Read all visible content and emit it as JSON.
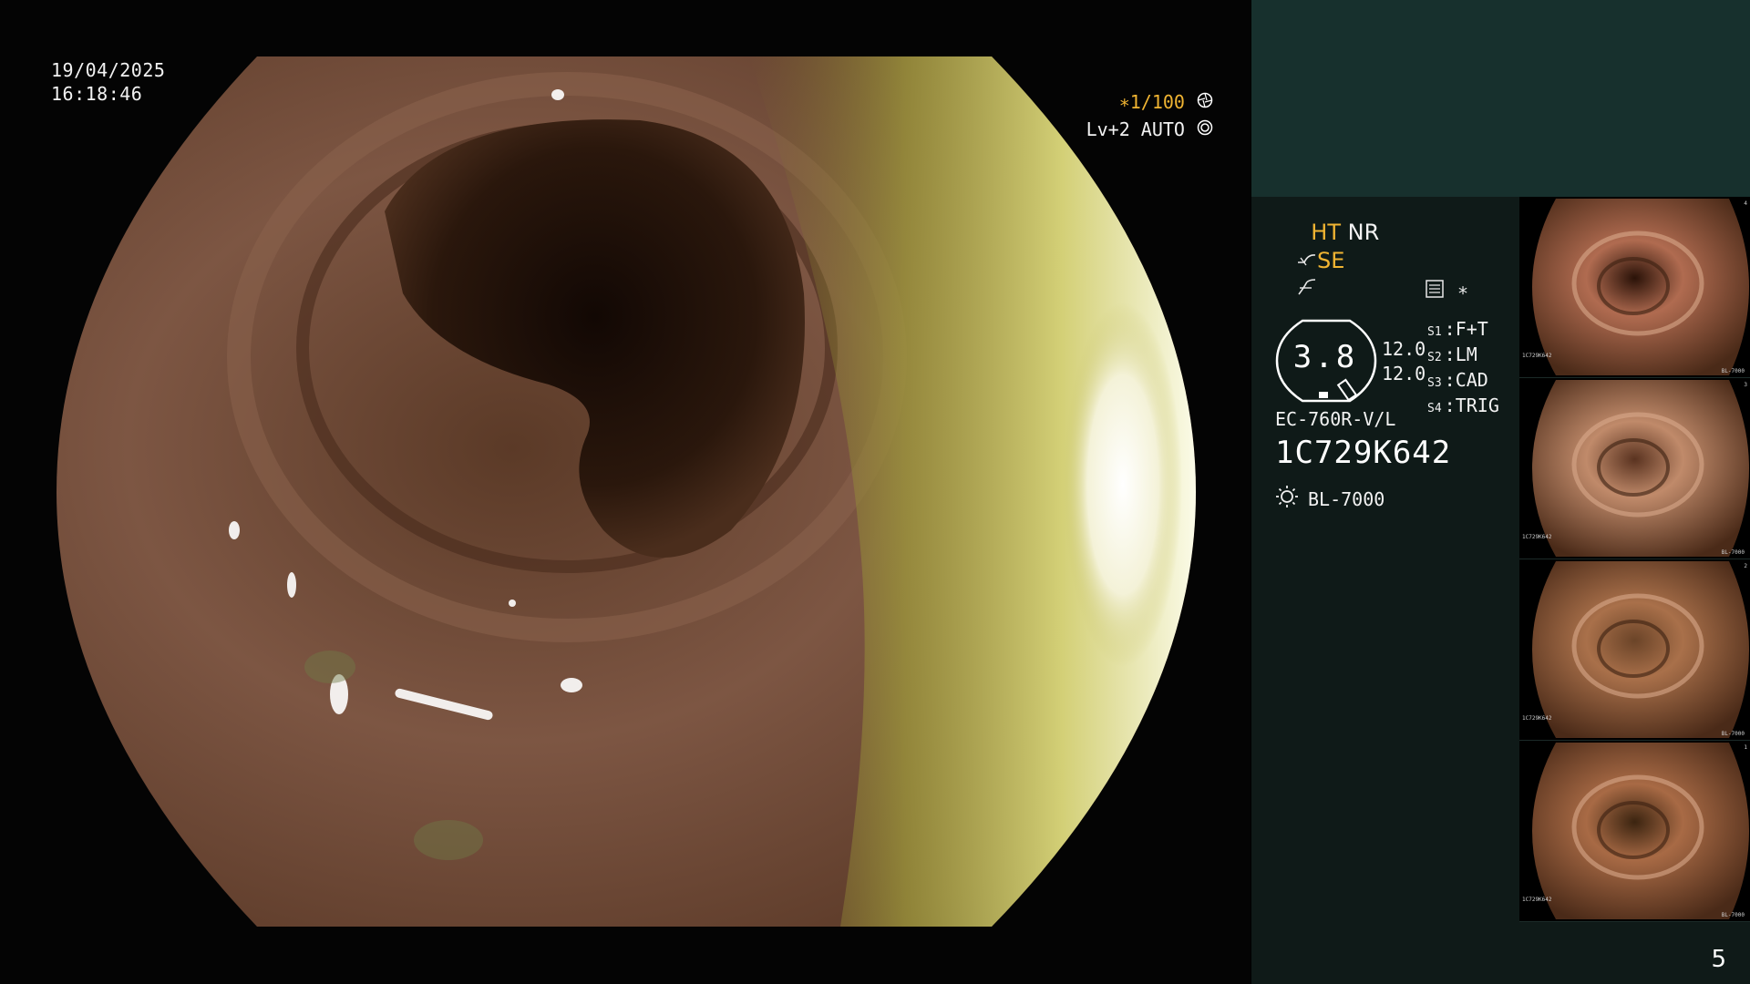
{
  "view": {
    "date": "19/04/2025",
    "time": "16:18:46",
    "shutter": "∗1/100",
    "level": "Lv+2 AUTO",
    "shutter_icon": "aperture-icon",
    "auto_icon": "iris-icon"
  },
  "panel": {
    "mode_ht": "HT",
    "mode_nr": "NR",
    "mode_se": "SE",
    "tone_icon": "tone-curve-icon",
    "enhance_icon": "enhance-curve-icon",
    "record_icon": "record-settings-icon",
    "asterisk": "∗",
    "dial_value": "3.8",
    "level_1": "12.0",
    "level_2": "12.0",
    "switches": [
      {
        "key": "S1",
        "value": "F+T"
      },
      {
        "key": "S2",
        "value": "LM"
      },
      {
        "key": "S3",
        "value": "CAD"
      },
      {
        "key": "S4",
        "value": "TRIG"
      }
    ],
    "scope_model": "EC-760R-V/L",
    "scope_serial": "1C729K642",
    "light_source": "BL-7000",
    "light_icon": "light-source-icon",
    "page_number": "5"
  },
  "thumbnails": [
    {
      "name": "capture-1",
      "tint": "#b06b50",
      "lumen": "#2a1208",
      "serial": "1C729K642",
      "light": "BL-7000",
      "index": "4"
    },
    {
      "name": "capture-2",
      "tint": "#c08a6a",
      "lumen": "#5a3320",
      "serial": "1C729K642",
      "light": "BL-7000",
      "index": "3"
    },
    {
      "name": "capture-3",
      "tint": "#a9704a",
      "lumen": "#6b4428",
      "serial": "1C729K642",
      "light": "BL-7000",
      "index": "2"
    },
    {
      "name": "capture-4",
      "tint": "#a86a45",
      "lumen": "#3b2410",
      "serial": "1C729K642",
      "light": "BL-7000",
      "index": "1"
    }
  ]
}
